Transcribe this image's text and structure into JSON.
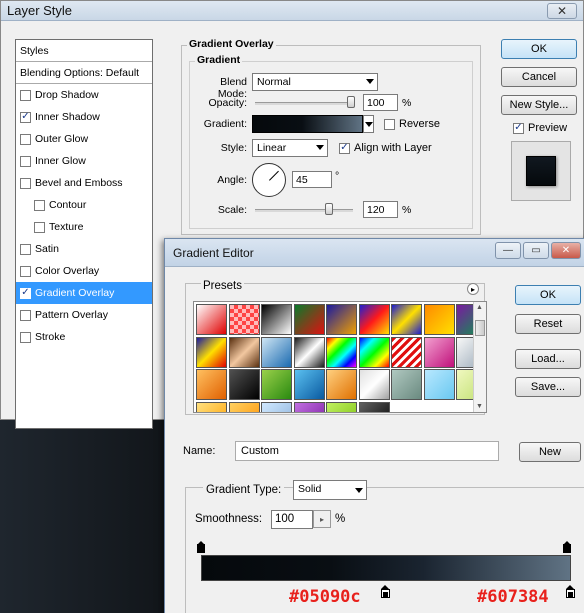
{
  "layer_style": {
    "title": "Layer Style",
    "styles_header": "Styles",
    "blending_options": "Blending Options: Default",
    "items": [
      {
        "label": "Drop Shadow",
        "checked": false
      },
      {
        "label": "Inner Shadow",
        "checked": true
      },
      {
        "label": "Outer Glow",
        "checked": false
      },
      {
        "label": "Inner Glow",
        "checked": false
      },
      {
        "label": "Bevel and Emboss",
        "checked": false
      },
      {
        "label": "Contour",
        "checked": false
      },
      {
        "label": "Texture",
        "checked": false
      },
      {
        "label": "Satin",
        "checked": false
      },
      {
        "label": "Color Overlay",
        "checked": false
      },
      {
        "label": "Gradient Overlay",
        "checked": true,
        "active": true
      },
      {
        "label": "Pattern Overlay",
        "checked": false
      },
      {
        "label": "Stroke",
        "checked": false
      }
    ],
    "panel": {
      "group_title": "Gradient Overlay",
      "sub_title": "Gradient",
      "blend_mode_label": "Blend Mode:",
      "blend_mode_value": "Normal",
      "opacity_label": "Opacity:",
      "opacity_value": "100",
      "opacity_unit": "%",
      "gradient_label": "Gradient:",
      "reverse_label": "Reverse",
      "style_label": "Style:",
      "style_value": "Linear",
      "align_label": "Align with Layer",
      "angle_label": "Angle:",
      "angle_value": "45",
      "angle_unit": "°",
      "scale_label": "Scale:",
      "scale_value": "120",
      "scale_unit": "%"
    },
    "buttons": {
      "ok": "OK",
      "cancel": "Cancel",
      "new_style": "New Style...",
      "preview_label": "Preview"
    }
  },
  "gradient_editor": {
    "title": "Gradient Editor",
    "presets_label": "Presets",
    "name_label": "Name:",
    "name_value": "Custom",
    "gradient_type_label": "Gradient Type:",
    "gradient_type_value": "Solid",
    "smoothness_label": "Smoothness:",
    "smoothness_value": "100",
    "smoothness_unit": "%",
    "buttons": {
      "ok": "OK",
      "reset": "Reset",
      "load": "Load...",
      "save": "Save...",
      "new": "New"
    },
    "color_stop_left": "#05090c",
    "color_stop_right": "#607384"
  },
  "colors": {
    "accent": "#3399ff",
    "annotation_red": "#e8211c"
  }
}
